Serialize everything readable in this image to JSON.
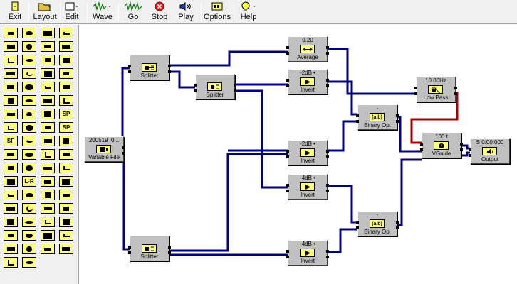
{
  "toolbar": {
    "exit": "Exit",
    "layout": "Layout",
    "edit": "Edit",
    "wave": "Wave",
    "go": "Go",
    "stop": "Stop",
    "play": "Play",
    "options": "Options",
    "help": "Help"
  },
  "palette": {
    "icons": [
      "bars",
      "speaker",
      "arrow-split",
      "arrow-join",
      "hump",
      "scope",
      "scope-a",
      "scope-b",
      "wave",
      "stripes",
      "card",
      "disk",
      "wrench",
      "monitor",
      "monitor-b",
      "monitor-c",
      "chart",
      "gear",
      "down-arrow",
      "bar-chart",
      "bell",
      "steps",
      "staircase",
      "plot",
      "chip",
      "bars-b",
      "steps-b",
      "SP",
      "x-mark",
      "dots",
      "plus",
      "SP-b",
      "SF",
      "scissors",
      "knob",
      "play-b",
      "slope",
      "clock",
      "turn",
      "dot",
      "bars-c",
      "monitor-d",
      "mic",
      "light",
      "oo",
      "LR",
      "bubble",
      "timer",
      "chart-b",
      "ladder",
      "gauge",
      "split",
      "pipe",
      "split-b",
      "pipe-b",
      "wave-b",
      "stripes-b",
      "clip",
      "triangle",
      "wave-c",
      "monitor-e",
      "pipe-c",
      "monitor-f",
      "lines",
      "wave-d",
      "wave-e",
      "pipe-d",
      "minus",
      "E",
      "curve"
    ],
    "texts": {
      "sp": "SP",
      "sf": "SF",
      "lr": "L-R"
    }
  },
  "blocks": {
    "variable_file": {
      "caption": "200519_0...",
      "label": "Variable File"
    },
    "splitter1": {
      "label": "Splitter"
    },
    "splitter2": {
      "label": "Splitter"
    },
    "splitter3": {
      "label": "Splitter"
    },
    "average": {
      "caption": "0.20",
      "label": "Average"
    },
    "invert1": {
      "caption": "-2dB •",
      "label": "Invert"
    },
    "invert2": {
      "caption": "-2dB •",
      "label": "Invert"
    },
    "invert3": {
      "caption": "-4dB •",
      "label": "Invert"
    },
    "invert4": {
      "caption": "-4dB •",
      "label": "Invert"
    },
    "binop1": {
      "caption": "-",
      "label": "Binary Op.",
      "glyph": "(a,b)"
    },
    "binop2": {
      "caption": "-",
      "label": "Binary Op.",
      "glyph": "(a,b)"
    },
    "lowpass": {
      "caption": "10.00Hz",
      "label": "Low Pass"
    },
    "vguide": {
      "caption": "100 t",
      "label": "VGuide"
    },
    "output": {
      "caption": "S 0:00.000",
      "label": "Output"
    }
  },
  "colors": {
    "wire": "#000080",
    "feedback_wire": "#a00000",
    "block_icon": "#ffff80",
    "block_face": "#c0c0c0"
  }
}
